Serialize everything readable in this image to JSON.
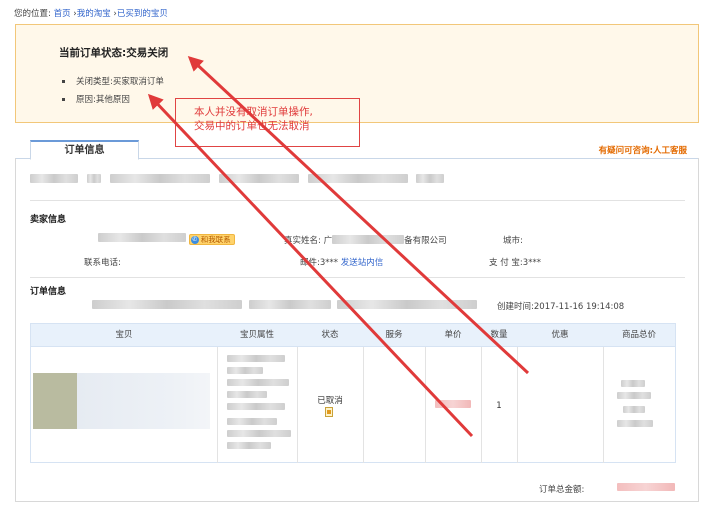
{
  "breadcrumb": {
    "prefix": "您的位置:",
    "home": "首页",
    "sep1": "›",
    "my_taobao": "我的淘宝",
    "sep2": "›",
    "bought": "已买到的宝贝"
  },
  "status": {
    "title": "当前订单状态:交易关闭",
    "close_type": "关闭类型:买家取消订单",
    "reason": "原因:其他原因"
  },
  "annotation": {
    "line1": "本人并没有取消订单操作,",
    "line2": "交易中的订单也无法取消"
  },
  "tabs": {
    "order_info": "订单信息",
    "help": "有疑问可咨询:人工客服"
  },
  "seller": {
    "section_title": "卖家信息",
    "contact_badge": "和我联系",
    "real_name_label": "真实姓名:",
    "real_name_value_prefix": "广",
    "real_name_value_suffix": "备有限公司",
    "city_label": "城市:",
    "phone_label": "联系电话:",
    "email_label": "邮件:",
    "email_value": "3***",
    "send_msg": "发送站内信",
    "alipay_label": "支 付 宝:",
    "alipay_value": "3***"
  },
  "order": {
    "section_title": "订单信息",
    "created_label": "创建时间:",
    "created_value": "2017-11-16 19:14:08"
  },
  "table": {
    "headers": [
      "宝贝",
      "宝贝属性",
      "状态",
      "服务",
      "单价",
      "数量",
      "优惠",
      "商品总价"
    ],
    "status_value": "已取消",
    "quantity": "1"
  },
  "footer": {
    "total_label": "订单总金额:"
  },
  "colors": {
    "annotation_red": "#e03a3a",
    "link_blue": "#3366cc",
    "help_orange": "#e36a00",
    "status_bg": "#fff8ea"
  }
}
